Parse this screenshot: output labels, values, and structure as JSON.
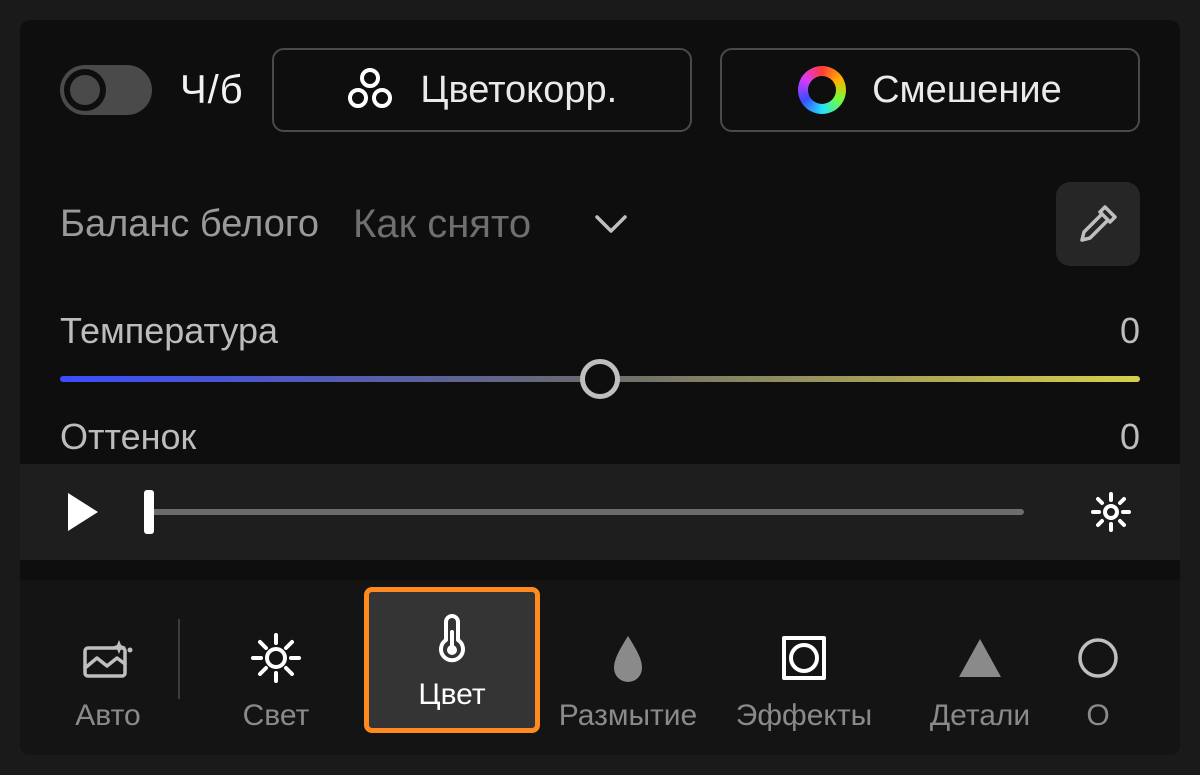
{
  "top": {
    "bw_label": "Ч/б",
    "color_correction": "Цветокорр.",
    "mixing": "Смешение"
  },
  "wb": {
    "label": "Баланс белого",
    "selected": "Как снято"
  },
  "sliders": {
    "temperature": {
      "label": "Температура",
      "value": "0"
    },
    "tint": {
      "label": "Оттенок",
      "value": "0"
    }
  },
  "tabs": {
    "auto": "Авто",
    "light": "Свет",
    "color": "Цвет",
    "blur": "Размытие",
    "effects": "Эффекты",
    "detail": "Детали",
    "optics": "О"
  }
}
